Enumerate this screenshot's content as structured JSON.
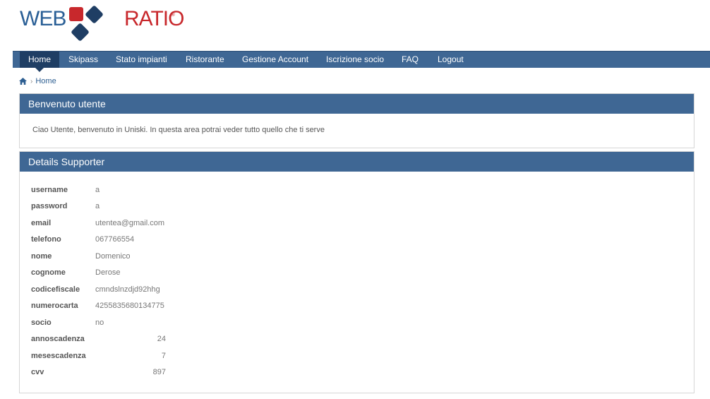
{
  "logo": {
    "left": "WEB",
    "right": "RATIO",
    "mark": "®"
  },
  "nav": {
    "items": [
      "Home",
      "Skipass",
      "Stato impianti",
      "Ristorante",
      "Gestione Account",
      "Iscrizione socio",
      "FAQ",
      "Logout"
    ],
    "active": "Home"
  },
  "breadcrumb": {
    "icon": "home-icon",
    "separator": "›",
    "current": "Home"
  },
  "welcome": {
    "title": "Benvenuto utente",
    "text": "Ciao Utente, benvenuto in Uniski. In questa area potrai veder tutto quello che ti serve"
  },
  "details": {
    "title": "Details Supporter",
    "fields": [
      {
        "label": "username",
        "value": "a"
      },
      {
        "label": "password",
        "value": "a"
      },
      {
        "label": "email",
        "value": "utentea@gmail.com"
      },
      {
        "label": "telefono",
        "value": "067766554"
      },
      {
        "label": "nome",
        "value": "Domenico"
      },
      {
        "label": "cognome",
        "value": "Derose"
      },
      {
        "label": "codicefiscale",
        "value": "cmndslnzdjd92hhg"
      },
      {
        "label": "numerocarta",
        "value": "4255835680134775"
      },
      {
        "label": "socio",
        "value": "no"
      },
      {
        "label": "annoscadenza",
        "value": "24"
      },
      {
        "label": "mesescadenza",
        "value": "7"
      },
      {
        "label": "cvv",
        "value": "897"
      }
    ]
  },
  "colors": {
    "nav_bg": "#3f6794",
    "nav_active": "#1f3e64",
    "panel_header": "#3f6794",
    "logo_blue": "#2a5f96",
    "logo_red": "#c8282c"
  }
}
